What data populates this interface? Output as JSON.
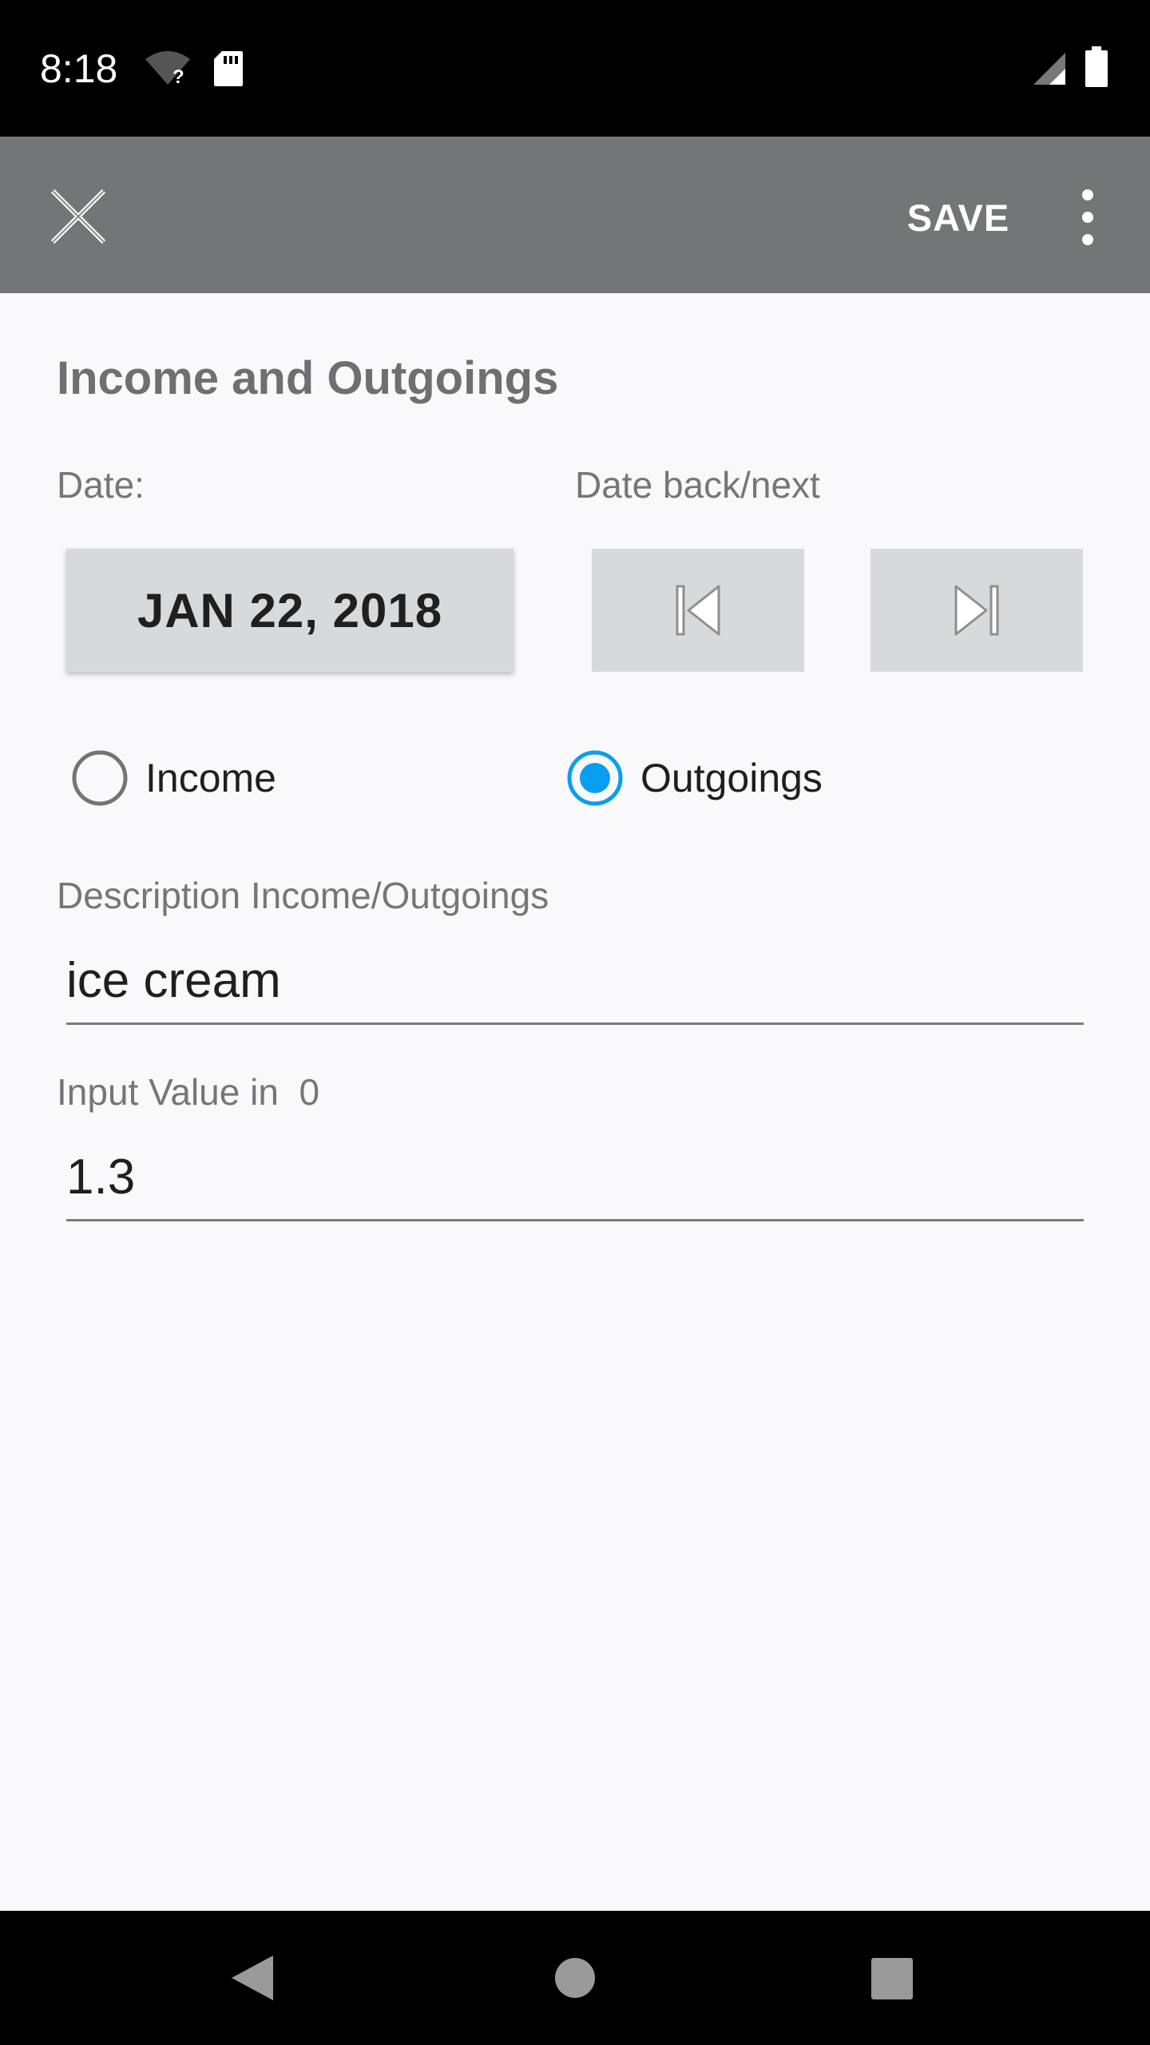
{
  "status_bar": {
    "time": "8:18",
    "icons": [
      "wifi-unknown-icon",
      "sd-card-icon",
      "signal-icon",
      "battery-icon"
    ]
  },
  "app_bar": {
    "close_icon": "close-icon",
    "save_label": "SAVE",
    "overflow_icon": "more-vert-icon"
  },
  "form": {
    "title": "Income and Outgoings",
    "date_label": "Date:",
    "date_nav_label": "Date back/next",
    "date_value": "JAN 22, 2018",
    "prev_icon": "skip-previous-icon",
    "next_icon": "skip-next-icon",
    "type_options": [
      {
        "label": "Income",
        "selected": false
      },
      {
        "label": "Outgoings",
        "selected": true
      }
    ],
    "description_label": "Description Income/Outgoings",
    "description_value": "ice cream",
    "value_label": "Input Value in  0",
    "value_value": "1.3"
  },
  "colors": {
    "app_bar": "#737577",
    "accent": "#0a9ef0",
    "background": "#f9f8fb"
  },
  "nav_bar": {
    "icons": [
      "back-icon",
      "home-icon",
      "recents-icon"
    ]
  }
}
